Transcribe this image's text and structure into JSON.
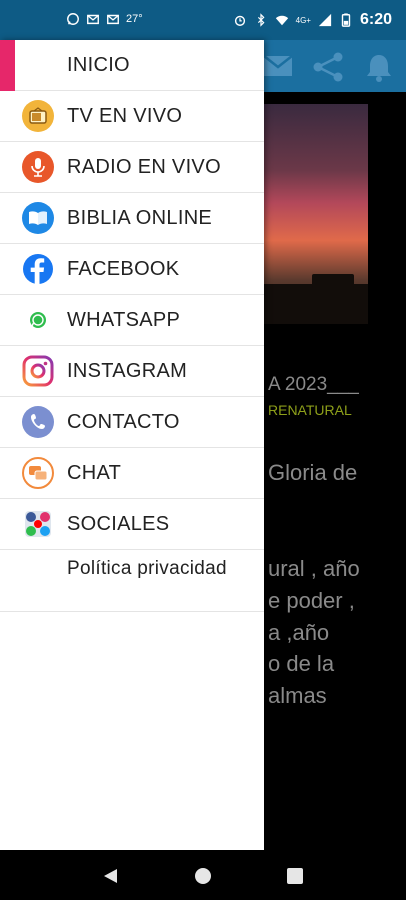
{
  "status_bar": {
    "temperature": "27°",
    "time": "6:20",
    "network": "4G+",
    "left_icons": [
      "whatsapp-icon",
      "gmail-icon",
      "gmail-icon"
    ],
    "right_icons": [
      "alarm-icon",
      "bluetooth-icon",
      "wifi-icon",
      "signal-icon",
      "battery-icon"
    ]
  },
  "drawer": {
    "items": [
      {
        "label": "INICIO",
        "icon": "none"
      },
      {
        "label": "TV EN VIVO",
        "icon": "tv-icon"
      },
      {
        "label": "RADIO EN VIVO",
        "icon": "microphone-icon"
      },
      {
        "label": "BIBLIA ONLINE",
        "icon": "book-icon"
      },
      {
        "label": "FACEBOOK",
        "icon": "facebook-icon"
      },
      {
        "label": "WHATSAPP",
        "icon": "whatsapp-icon"
      },
      {
        "label": "INSTAGRAM",
        "icon": "instagram-icon"
      },
      {
        "label": "CONTACTO",
        "icon": "phone-icon"
      },
      {
        "label": "CHAT",
        "icon": "chat-icon"
      },
      {
        "label": "SOCIALES",
        "icon": "social-icon"
      },
      {
        "label": "Política privacidad",
        "icon": "none"
      }
    ],
    "accent_color": "#e6276a"
  },
  "background": {
    "appbar_icons": [
      "mail-icon",
      "share-icon",
      "bell-icon"
    ],
    "appbar_color": "#1b6fa0",
    "post_title": "A 2023___",
    "post_subtitle": "RENATURAL",
    "post_heading": "Gloria de",
    "post_lines": [
      "ural , año",
      "e poder ,",
      "a ,año",
      "o de la",
      "almas"
    ]
  },
  "nav_bar": {
    "icons": [
      "back-icon",
      "home-icon",
      "recents-icon"
    ]
  }
}
